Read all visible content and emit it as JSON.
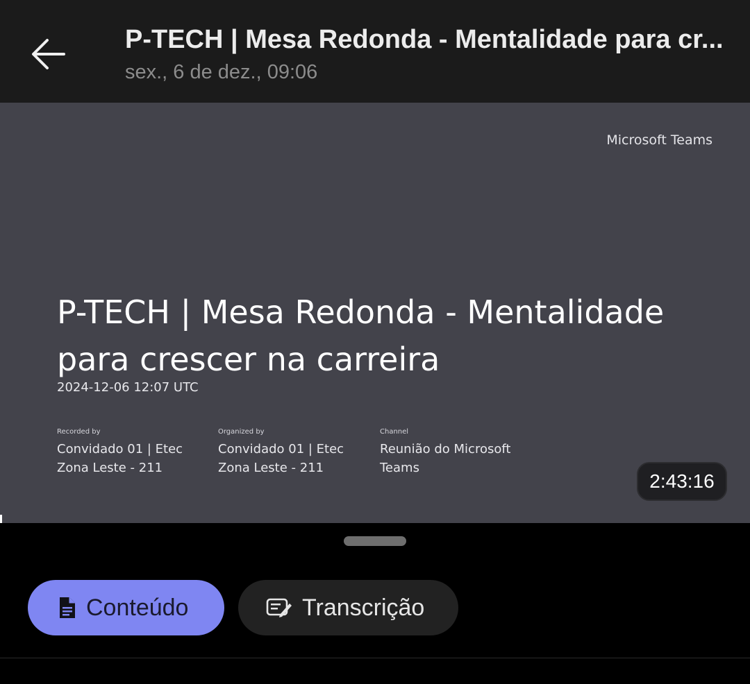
{
  "header": {
    "title": "P-TECH | Mesa Redonda - Mentalidade para cr...",
    "subtitle": "sex., 6 de dez., 09:06"
  },
  "video": {
    "brand": "Microsoft Teams",
    "title": "P-TECH | Mesa Redonda - Mentalidade para crescer na carreira",
    "date": "2024-12-06 12:07 UTC",
    "recorded_by": {
      "label": "Recorded by",
      "value": "Convidado 01 | Etec Zona Leste - 211"
    },
    "organized_by": {
      "label": "Organized by",
      "value": "Convidado 01 | Etec Zona Leste - 211"
    },
    "channel": {
      "label": "Channel",
      "value": "Reunião do Microsoft Teams"
    },
    "duration": "2:43:16"
  },
  "tabs": [
    {
      "label": "Conteúdo",
      "icon": "document-icon",
      "active": true
    },
    {
      "label": "Transcrição",
      "icon": "transcript-edit-icon",
      "active": false
    }
  ],
  "colors": {
    "accent": "#7f86f2",
    "header_bg": "#1b1b1b",
    "video_bg": "#43434b"
  }
}
